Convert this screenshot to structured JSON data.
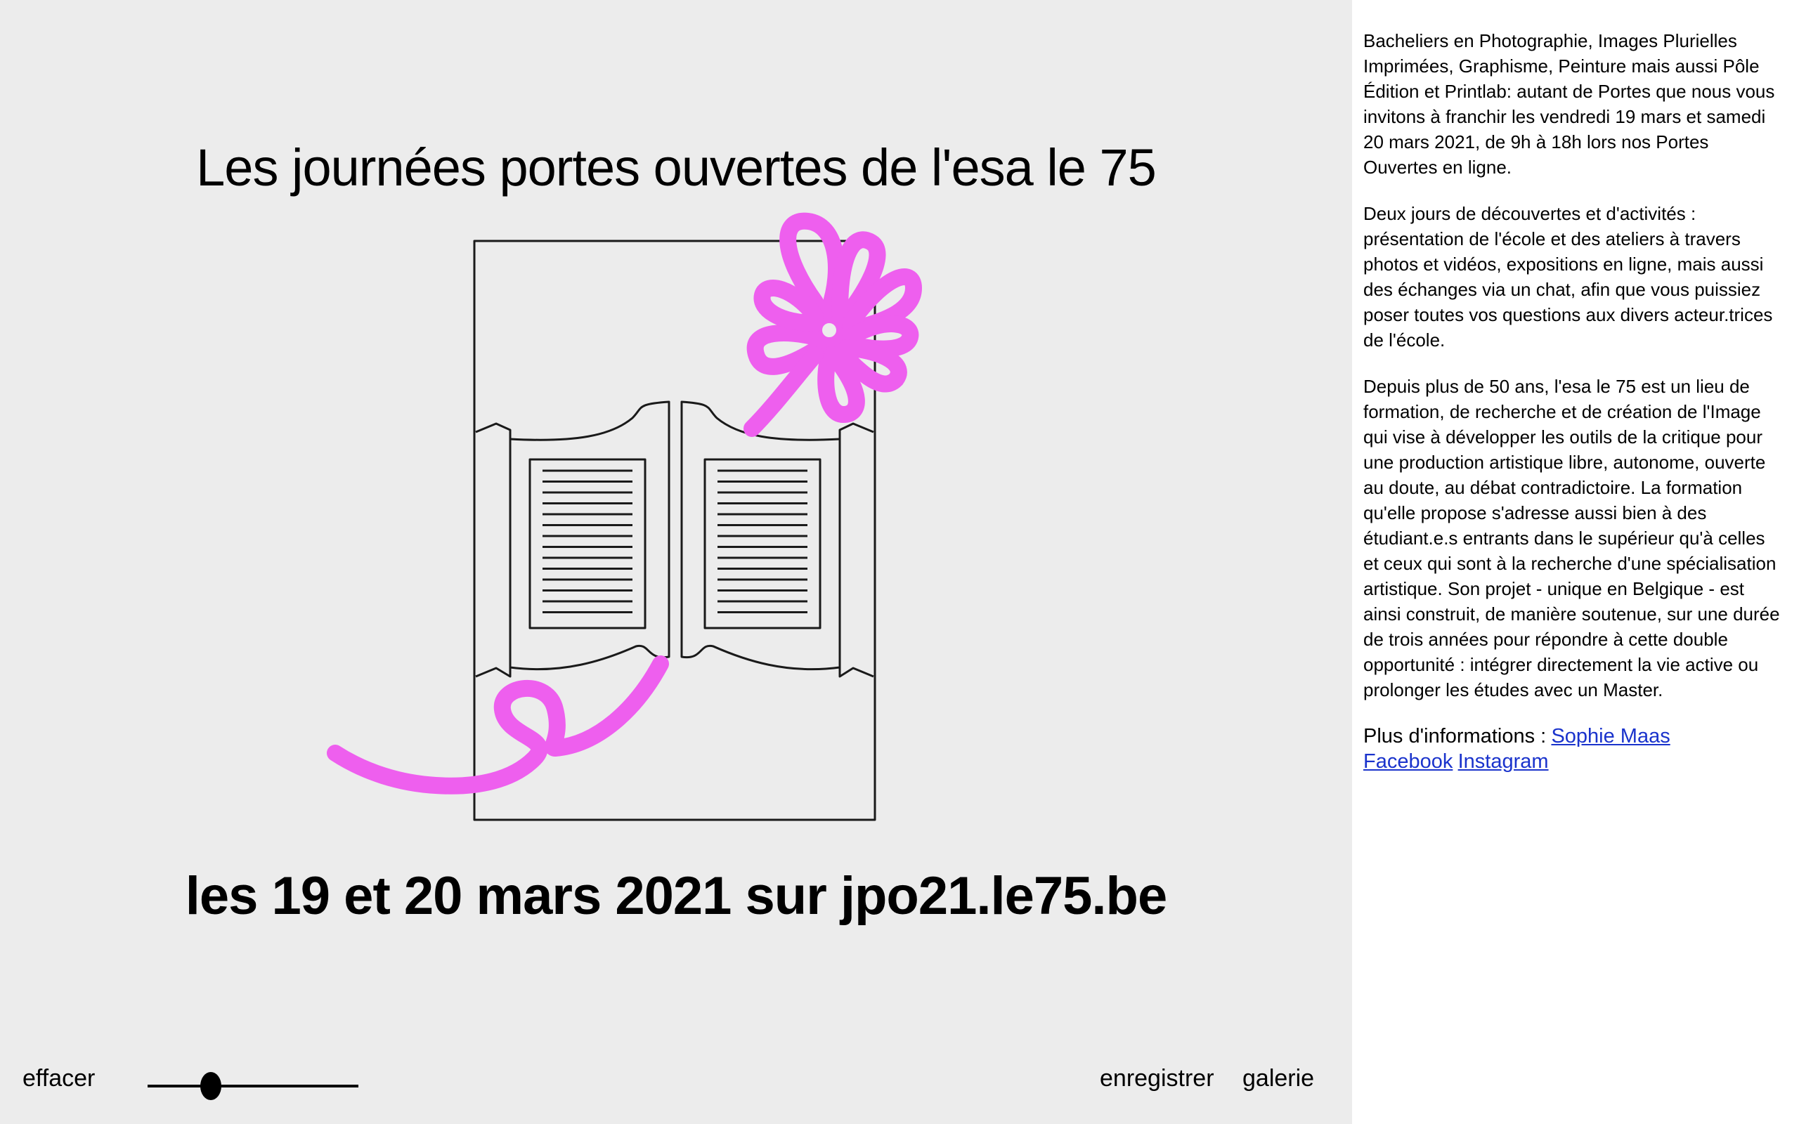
{
  "main": {
    "title": "Les journées portes ouvertes de l'esa le 75",
    "subtitle": "les 19 et 20 mars 2021 sur jpo21.le75.be",
    "drawing": {
      "stroke_color": "#ee5fee",
      "line_color": "#1a1a1a"
    }
  },
  "controls": {
    "clear_label": "effacer",
    "save_label": "enregistrer",
    "gallery_label": "galerie",
    "brush_size_slider": {
      "value_fraction": 0.3
    }
  },
  "sidebar": {
    "paragraphs": [
      "Bacheliers en Photographie, Images Plurielles Imprimées, Graphisme, Peinture mais aussi Pôle Édition et Printlab: autant de Portes que nous vous invitons à franchir les vendredi 19 mars et samedi 20 mars 2021, de 9h à 18h lors nos Portes Ouvertes en ligne.",
      "Deux jours de découvertes et d'activités : présentation de l'école et des ateliers à travers photos et vidéos, expositions en ligne, mais aussi des échanges via un chat, afin que vous puissiez poser toutes vos questions aux divers acteur.trices de l'école.",
      "Depuis plus de 50 ans, l'esa le 75 est un lieu de formation, de recherche et de création de l'Image qui vise à développer les outils de la critique pour une production artistique libre, autonome, ouverte au doute, au débat contradictoire. La formation qu'elle propose s'adresse aussi bien à des étudiant.e.s entrants dans le supérieur qu'à celles et ceux qui sont à la recherche d'une spécialisation artistique. Son projet - unique en Belgique - est ainsi construit, de manière soutenue, sur une durée de trois années pour répondre à cette double opportunité : intégrer directement la vie active ou prolonger les études avec un Master."
    ],
    "info_label": "Plus d'informations :",
    "links": {
      "contact": "Sophie Maas",
      "facebook": "Facebook",
      "instagram": "Instagram"
    },
    "link_color": "#1a33cc"
  }
}
